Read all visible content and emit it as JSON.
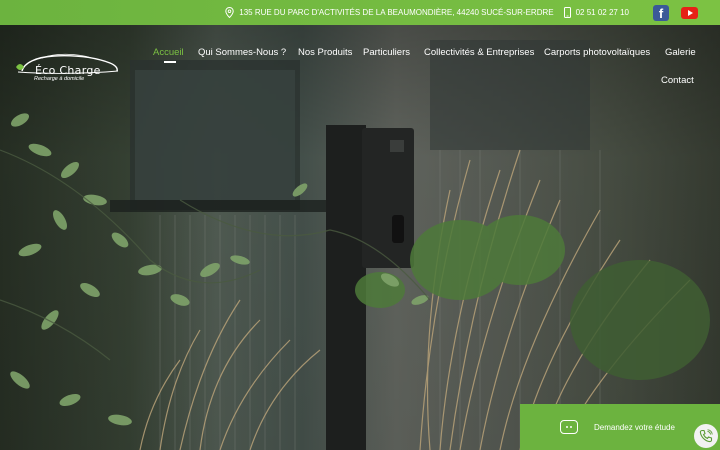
{
  "topbar": {
    "address": "135 RUE DU PARC D'ACTIVITÉS DE LA BEAUMONDIÈRE, 44240 SUCÉ-SUR-ERDRE",
    "phone": "02 51 02 27 10",
    "facebook_glyph": "f",
    "colors": {
      "bar": "#6cb33f",
      "facebook": "#3b5998",
      "youtube": "#e62117"
    }
  },
  "logo": {
    "brand": "Éco Charge",
    "tagline": "Recharge à domicile"
  },
  "nav": {
    "items": [
      {
        "label": "Accueil",
        "active": true
      },
      {
        "label": "Qui Sommes-Nous ?"
      },
      {
        "label": "Nos Produits"
      },
      {
        "label": "Particuliers"
      },
      {
        "label": "Collectivités & Entreprises"
      },
      {
        "label": "Carports photovoltaïques"
      },
      {
        "label": "Galerie"
      },
      {
        "label": "Contact"
      }
    ],
    "active_color": "#7cc243"
  },
  "cta": {
    "label": "Demandez votre étude"
  },
  "icons": [
    "map-pin-icon",
    "mobile-phone-icon",
    "facebook-icon",
    "youtube-icon",
    "car-logo-icon",
    "chat-icon",
    "phone-call-icon"
  ]
}
